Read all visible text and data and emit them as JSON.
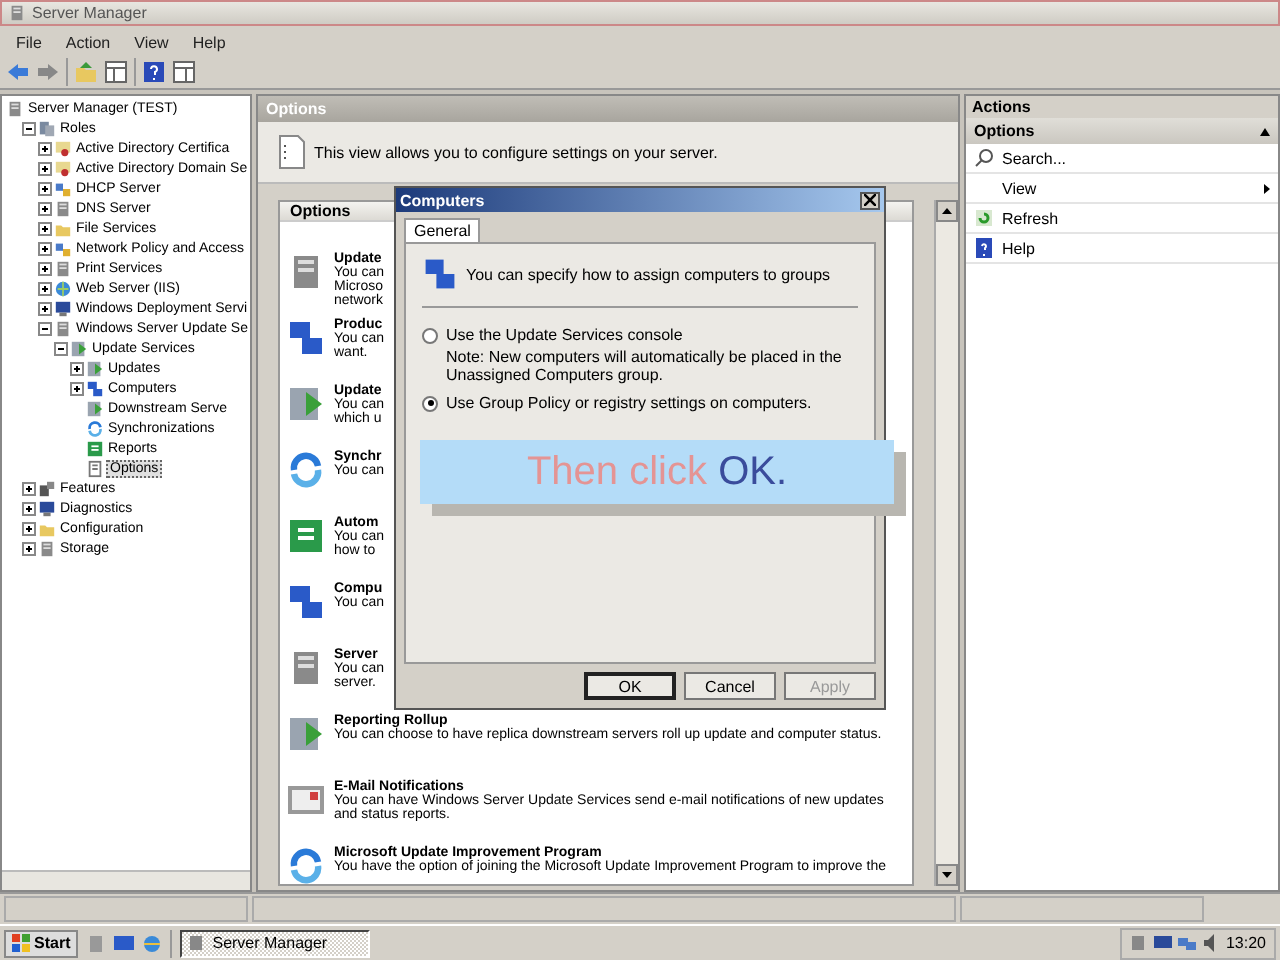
{
  "window": {
    "title": "Server Manager"
  },
  "menu": [
    {
      "label": "File"
    },
    {
      "label": "Action"
    },
    {
      "label": "View"
    },
    {
      "label": "Help"
    }
  ],
  "tree": [
    {
      "label": "Server Manager (TEST)",
      "selected": false,
      "children": [
        {
          "label": "Roles",
          "expanded": true,
          "selected": false,
          "children": [
            {
              "label": "Active Directory Certifica",
              "expanded": false,
              "selected": false
            },
            {
              "label": "Active Directory Domain Se",
              "expanded": false,
              "selected": false
            },
            {
              "label": "DHCP Server",
              "expanded": false,
              "selected": false
            },
            {
              "label": "DNS Server",
              "expanded": false,
              "selected": false
            },
            {
              "label": "File Services",
              "expanded": false,
              "selected": false
            },
            {
              "label": "Network Policy and Access",
              "expanded": false,
              "selected": false
            },
            {
              "label": "Print Services",
              "expanded": false,
              "selected": false
            },
            {
              "label": "Web Server (IIS)",
              "expanded": false,
              "selected": false
            },
            {
              "label": "Windows Deployment Servi",
              "expanded": false,
              "selected": false
            },
            {
              "label": "Windows Server Update Se",
              "expanded": true,
              "selected": false,
              "children": [
                {
                  "label": "Update Services",
                  "expanded": true,
                  "selected": false,
                  "children": [
                    {
                      "label": "Updates",
                      "expanded": false,
                      "selected": false
                    },
                    {
                      "label": "Computers",
                      "expanded": false,
                      "selected": false
                    },
                    {
                      "label": "Downstream Serve",
                      "selected": false
                    },
                    {
                      "label": "Synchronizations",
                      "selected": false
                    },
                    {
                      "label": "Reports",
                      "selected": false
                    },
                    {
                      "label": "Options",
                      "selected": true
                    }
                  ]
                }
              ]
            }
          ]
        },
        {
          "label": "Features",
          "expanded": false,
          "selected": false
        },
        {
          "label": "Diagnostics",
          "expanded": false,
          "selected": false
        },
        {
          "label": "Configuration",
          "expanded": false,
          "selected": false
        },
        {
          "label": "Storage",
          "expanded": false,
          "selected": false
        }
      ]
    }
  ],
  "center": {
    "title": "Options",
    "description": "This view allows you to configure settings on your server.",
    "panel_title": "Options",
    "items": [
      {
        "title": "Update",
        "lines": [
          "You can",
          "Microso",
          "network"
        ]
      },
      {
        "title": "Produc",
        "lines": [
          "You can",
          "want."
        ]
      },
      {
        "title": "Update",
        "lines": [
          "You can",
          "which u"
        ]
      },
      {
        "title": "Synchr",
        "lines": [
          "You can"
        ]
      },
      {
        "title": "Autom",
        "lines": [
          "You can",
          "how to"
        ]
      },
      {
        "title": "Compu",
        "lines": [
          "You can"
        ]
      },
      {
        "title": "Server",
        "lines": [
          "You can",
          "server."
        ]
      },
      {
        "title": "Reporting Rollup",
        "lines": [
          "You can choose to have replica downstream servers roll up update and computer status."
        ]
      },
      {
        "title": "E-Mail Notifications",
        "lines": [
          "You can have Windows Server Update Services send e-mail notifications of new updates and status reports."
        ]
      },
      {
        "title": "Microsoft Update Improvement Program",
        "lines": [
          "You have the option of joining the Microsoft Update Improvement Program to improve the"
        ]
      }
    ]
  },
  "actions": {
    "title": "Actions",
    "section": "Options",
    "items": [
      {
        "kind": "search",
        "label": "Search..."
      },
      {
        "kind": "submenu",
        "label": "View"
      },
      {
        "kind": "refresh",
        "label": "Refresh"
      },
      {
        "kind": "help",
        "label": "Help"
      }
    ]
  },
  "dialog": {
    "title": "Computers",
    "tabs": [
      {
        "label": "General",
        "selected": true
      }
    ],
    "intro": "You can specify how to assign computers to groups",
    "options": [
      {
        "label": "Use the Update Services console",
        "selected": false,
        "note": "Note: New computers will automatically be placed in the Unassigned Computers group."
      },
      {
        "label": "Use Group Policy or registry settings on computers.",
        "selected": true
      }
    ],
    "buttons": [
      {
        "label": "OK",
        "disabled": false,
        "default": true
      },
      {
        "label": "Cancel",
        "disabled": false,
        "default": false
      },
      {
        "label": "Apply",
        "disabled": true,
        "default": false
      }
    ]
  },
  "callout": {
    "text": "Then click ",
    "highlight": "OK."
  },
  "taskbar": {
    "start": "Start",
    "tasks": [
      {
        "label": "Server Manager",
        "selected": true
      }
    ],
    "clock": "13:20"
  }
}
